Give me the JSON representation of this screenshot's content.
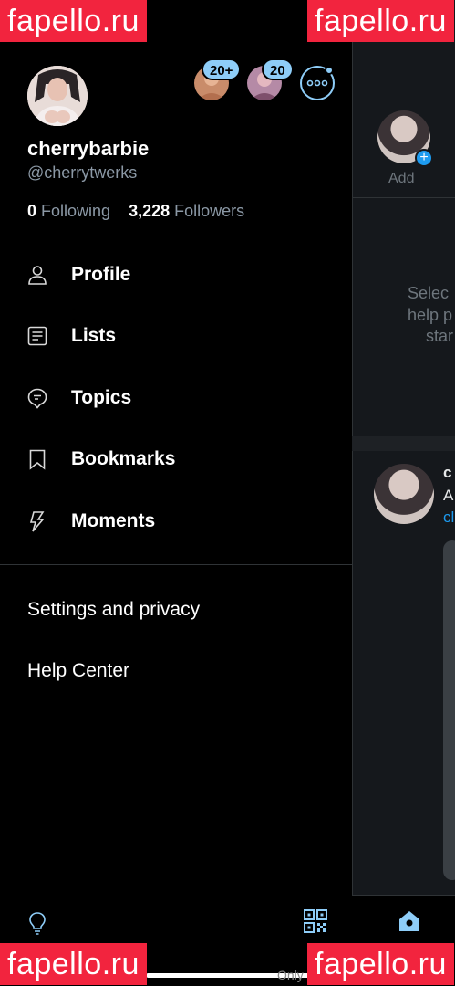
{
  "profile": {
    "display_name": "cherrybarbie",
    "handle": "@cherrytwerks",
    "following_count": "0",
    "following_label": "Following",
    "followers_count": "3,228",
    "followers_label": "Followers"
  },
  "accounts": [
    {
      "badge": "20+"
    },
    {
      "badge": "20"
    }
  ],
  "menu": [
    {
      "label": "Profile",
      "icon": "person-icon"
    },
    {
      "label": "Lists",
      "icon": "lists-icon"
    },
    {
      "label": "Topics",
      "icon": "topics-icon"
    },
    {
      "label": "Bookmarks",
      "icon": "bookmark-icon"
    },
    {
      "label": "Moments",
      "icon": "lightning-icon"
    }
  ],
  "secondary": [
    {
      "label": "Settings and privacy"
    },
    {
      "label": "Help Center"
    }
  ],
  "background": {
    "add_label": "Add",
    "prompt_lines": [
      "Selec",
      "help p",
      "star"
    ],
    "tweet_name": "c",
    "tweet_lines": [
      "A",
      "cl"
    ]
  },
  "watermark": "fapello.ru",
  "bottom_text": "Only",
  "colors": {
    "accent": "#8ecdf8",
    "link": "#1d9bf0",
    "watermark_bg": "#f2243e",
    "muted": "#8b98a5"
  }
}
